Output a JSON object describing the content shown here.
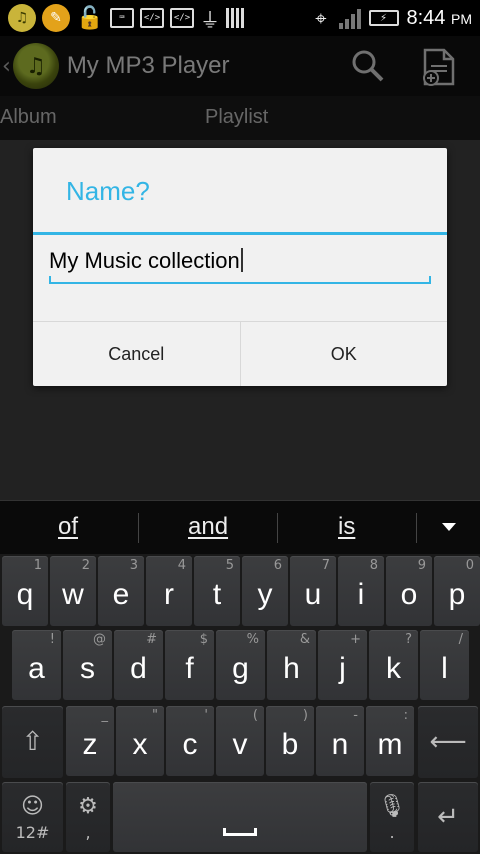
{
  "status_bar": {
    "time": "8:44",
    "ampm": "PM"
  },
  "app": {
    "title": "My MP3 Player"
  },
  "tabs": [
    {
      "label": "Album"
    },
    {
      "label": "Playlist"
    }
  ],
  "dialog": {
    "title": "Name?",
    "input_value": "My Music collection",
    "cancel_label": "Cancel",
    "ok_label": "OK"
  },
  "suggestions": [
    "of",
    "and",
    "is"
  ],
  "keyboard": {
    "row1": [
      {
        "k": "q",
        "h": "1"
      },
      {
        "k": "w",
        "h": "2"
      },
      {
        "k": "e",
        "h": "3"
      },
      {
        "k": "r",
        "h": "4"
      },
      {
        "k": "t",
        "h": "5"
      },
      {
        "k": "y",
        "h": "6"
      },
      {
        "k": "u",
        "h": "7"
      },
      {
        "k": "i",
        "h": "8"
      },
      {
        "k": "o",
        "h": "9"
      },
      {
        "k": "p",
        "h": "0"
      }
    ],
    "row2": [
      {
        "k": "a",
        "h": "!"
      },
      {
        "k": "s",
        "h": "@"
      },
      {
        "k": "d",
        "h": "#"
      },
      {
        "k": "f",
        "h": "$"
      },
      {
        "k": "g",
        "h": "%"
      },
      {
        "k": "h",
        "h": "&"
      },
      {
        "k": "j",
        "h": "+"
      },
      {
        "k": "k",
        "h": "?"
      },
      {
        "k": "l",
        "h": "/"
      }
    ],
    "row3": [
      {
        "k": "z",
        "h": "_"
      },
      {
        "k": "x",
        "h": "\""
      },
      {
        "k": "c",
        "h": "'"
      },
      {
        "k": "v",
        "h": "("
      },
      {
        "k": "b",
        "h": ")"
      },
      {
        "k": "n",
        "h": "-"
      },
      {
        "k": "m",
        "h": ":"
      }
    ],
    "symbols_label": "12#",
    "comma_label": ",",
    "period_label": "."
  }
}
